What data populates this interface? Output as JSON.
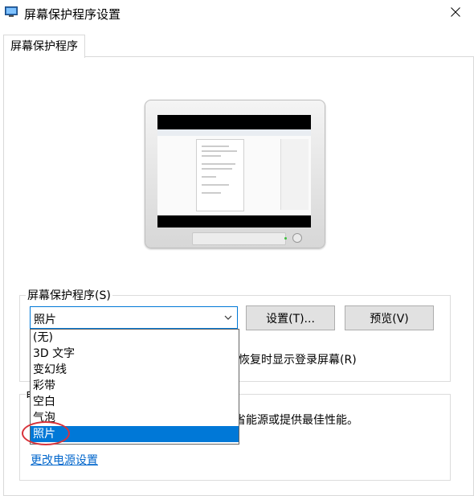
{
  "window": {
    "title": "屏幕保护程序设置",
    "icon": "screensaver-app-icon",
    "close_icon": "close-icon"
  },
  "tabs": [
    {
      "label": "屏幕保护程序",
      "active": true
    }
  ],
  "screensaver_group": {
    "label": "屏幕保护程序(S)",
    "selected_value": "照片",
    "settings_button": "设置(T)...",
    "preview_button": "预览(V)",
    "resume_text": "恢复时显示登录屏幕(R)"
  },
  "dropdown": {
    "items": [
      "(无)",
      "3D 文字",
      "变幻线",
      "彩带",
      "空白",
      "气泡",
      "照片"
    ],
    "selected_index": 6
  },
  "power_group": {
    "label_fragment": "电",
    "description_fragment": "省能源或提供最佳性能。",
    "link": "更改电源设置"
  },
  "colors": {
    "accent": "#0078d7",
    "link": "#0066cc",
    "highlight": "#d8323a"
  }
}
